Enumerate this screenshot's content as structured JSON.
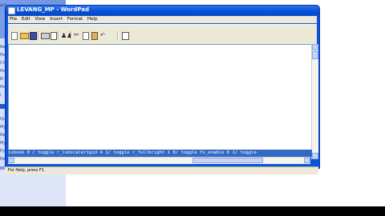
{
  "window": {
    "title": "LEVANG_MP - WordPad"
  },
  "menu": {
    "items": [
      "File",
      "Edit",
      "View",
      "Insert",
      "Format",
      "Help"
    ]
  },
  "toolbar": {
    "find_glyph": "♟♟",
    "cut_glyph": "✂",
    "undo_glyph": "↶"
  },
  "editor": {
    "selected_line": "isbook 0 / toggle r_lodscalerigid 4 1/ toggle r_fullbright 1 0/ toggle fx_enable 0 1/ toggle"
  },
  "statusbar": {
    "text": "For Help, press F1"
  },
  "background": {
    "side_letters": [
      "ack",
      "Re",
      "Pe",
      "Ch",
      "Pe",
      "Er",
      "Pe",
      "i",
      "Qu",
      "My",
      "Ne",
      "My",
      "Py",
      "Ne"
    ],
    "close_glyph": "×"
  },
  "colors": {
    "titlebar": "#0a55d9",
    "selection": "#316ac5",
    "chrome": "#ece9d8"
  }
}
